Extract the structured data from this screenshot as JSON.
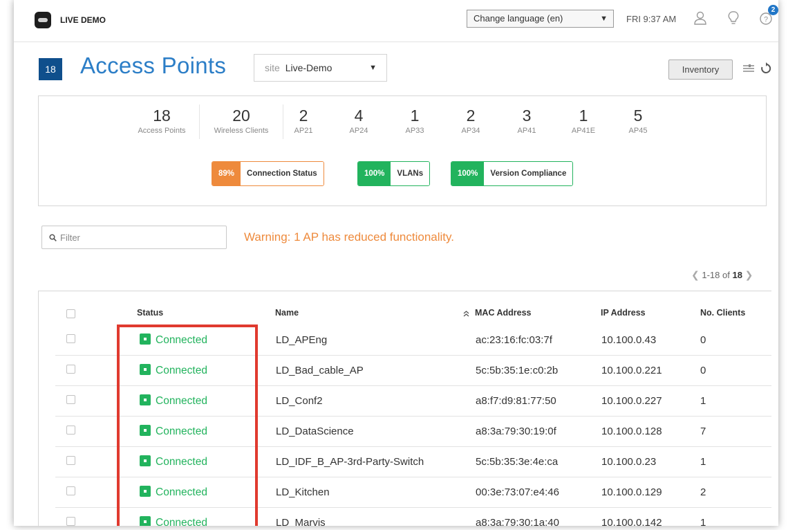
{
  "header": {
    "org_name": "LIVE DEMO",
    "language_button": "Change language (en)",
    "time": "FRI 9:37 AM",
    "help_badge": "2",
    "icons": [
      "user-icon",
      "lightbulb-icon",
      "help-icon"
    ]
  },
  "page": {
    "count": "18",
    "title": "Access Points",
    "site_prefix": "site",
    "site_value": "Live-Demo",
    "inventory_button": "Inventory"
  },
  "stats": [
    {
      "value": "18",
      "label": "Access Points"
    },
    {
      "value": "20",
      "label": "Wireless Clients"
    },
    {
      "value": "2",
      "label": "AP21"
    },
    {
      "value": "4",
      "label": "AP24"
    },
    {
      "value": "1",
      "label": "AP33"
    },
    {
      "value": "2",
      "label": "AP34"
    },
    {
      "value": "3",
      "label": "AP41"
    },
    {
      "value": "1",
      "label": "AP41E"
    },
    {
      "value": "5",
      "label": "AP45"
    }
  ],
  "sle": [
    {
      "pct": "89%",
      "label": "Connection Status",
      "color": "#ee8a3c"
    },
    {
      "pct": "100%",
      "label": "VLANs",
      "color": "#22b35d"
    },
    {
      "pct": "100%",
      "label": "Version Compliance",
      "color": "#22b35d"
    }
  ],
  "filter": {
    "placeholder": "Filter"
  },
  "warning": "Warning: 1 AP has reduced functionality.",
  "pagination": {
    "range": "1-18 of",
    "total": "18"
  },
  "table": {
    "columns": [
      "Status",
      "Name",
      "MAC Address",
      "IP Address",
      "No. Clients"
    ],
    "sort_icon": "sort-ascending-icon",
    "rows": [
      {
        "status": "Connected",
        "name": "LD_APEng",
        "mac": "ac:23:16:fc:03:7f",
        "ip": "10.100.0.43",
        "clients": "0"
      },
      {
        "status": "Connected",
        "name": "LD_Bad_cable_AP",
        "mac": "5c:5b:35:1e:c0:2b",
        "ip": "10.100.0.221",
        "clients": "0"
      },
      {
        "status": "Connected",
        "name": "LD_Conf2",
        "mac": "a8:f7:d9:81:77:50",
        "ip": "10.100.0.227",
        "clients": "1"
      },
      {
        "status": "Connected",
        "name": "LD_DataScience",
        "mac": "a8:3a:79:30:19:0f",
        "ip": "10.100.0.128",
        "clients": "7"
      },
      {
        "status": "Connected",
        "name": "LD_IDF_B_AP-3rd-Party-Switch",
        "mac": "5c:5b:35:3e:4e:ca",
        "ip": "10.100.0.23",
        "clients": "1"
      },
      {
        "status": "Connected",
        "name": "LD_Kitchen",
        "mac": "00:3e:73:07:e4:46",
        "ip": "10.100.0.129",
        "clients": "2"
      },
      {
        "status": "Connected",
        "name": "LD_Marvis",
        "mac": "a8:3a:79:30:1a:40",
        "ip": "10.100.0.142",
        "clients": "1"
      }
    ]
  }
}
